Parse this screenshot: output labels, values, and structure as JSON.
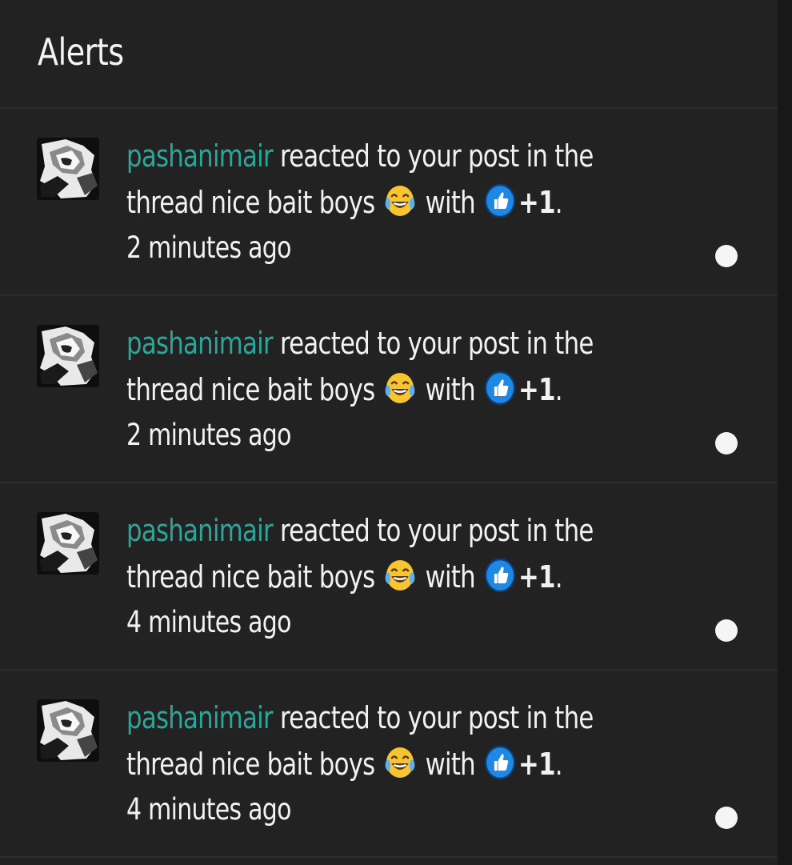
{
  "header": {
    "title": "Alerts"
  },
  "alerts": [
    {
      "username": "pashanimair",
      "text_before": " reacted to your post in the thread nice bait boys ",
      "text_with": " with ",
      "reaction": "+1",
      "end": ".",
      "time": "2 minutes ago"
    },
    {
      "username": "pashanimair",
      "text_before": " reacted to your post in the thread nice bait boys ",
      "text_with": " with ",
      "reaction": "+1",
      "end": ".",
      "time": "2 minutes ago"
    },
    {
      "username": "pashanimair",
      "text_before": " reacted to your post in the thread nice bait boys ",
      "text_with": " with ",
      "reaction": "+1",
      "end": ".",
      "time": "4 minutes ago"
    },
    {
      "username": "pashanimair",
      "text_before": " reacted to your post in the thread nice bait boys ",
      "text_with": " with ",
      "reaction": "+1",
      "end": ".",
      "time": "4 minutes ago"
    }
  ],
  "icons": {
    "avatar": "user-avatar",
    "emoji": "laughing-tears-emoji-icon",
    "reaction_icon": "thumbs-up-icon",
    "unread": "unread-dot-icon"
  },
  "colors": {
    "background": "#222222",
    "username": "#2aa79a",
    "text": "#f2f2f2",
    "thumb_blue": "#1e88e5"
  }
}
